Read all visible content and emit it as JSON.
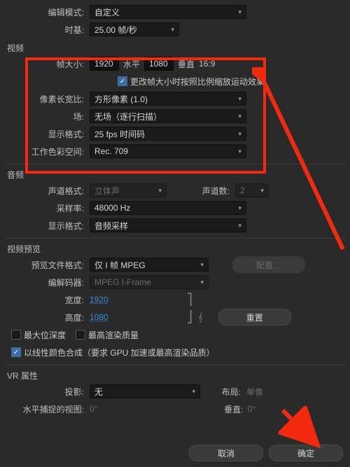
{
  "top": {
    "edit_mode_label": "编辑模式:",
    "edit_mode_value": "自定义",
    "timebase_label": "时基:",
    "timebase_value": "25.00 帧/秒"
  },
  "video": {
    "section": "视频",
    "frame_size_label": "帧大小:",
    "width": "1920",
    "h_label": "水平",
    "height": "1080",
    "v_label": "垂直",
    "ratio": "16:9",
    "scale_checkbox": "更改帧大小时按照比例缩放运动效果",
    "pixel_ar_label": "像素长宽比:",
    "pixel_ar_value": "方形像素 (1.0)",
    "fields_label": "场:",
    "fields_value": "无场（逐行扫描）",
    "disp_fmt_label": "显示格式:",
    "disp_fmt_value": "25 fps 时间码",
    "colorspace_label": "工作色彩空间:",
    "colorspace_value": "Rec. 709"
  },
  "audio": {
    "section": "音频",
    "ch_fmt_label": "声道格式:",
    "ch_fmt_value": "立体声",
    "ch_count_label": "声道数:",
    "ch_count_value": "2",
    "sample_rate_label": "采样率:",
    "sample_rate_value": "48000 Hz",
    "disp_fmt_label": "显示格式:",
    "disp_fmt_value": "音频采样"
  },
  "preview": {
    "section": "视频预览",
    "file_fmt_label": "预览文件格式:",
    "file_fmt_value": "仅 I 帧 MPEG",
    "config_btn": "配置…",
    "codec_label": "编解码器:",
    "codec_value": "MPEG I-Frame",
    "width_label": "宽度:",
    "width_value": "1920",
    "height_label": "高度:",
    "height_value": "1080",
    "reset_btn": "重置",
    "max_depth": "最大位深度",
    "max_quality": "最高渲染质量",
    "linear_comp": "以线性颜色合成（要求 GPU 加速或最高渲染品质）"
  },
  "vr": {
    "section": "VR 属性",
    "proj_label": "投影:",
    "proj_value": "无",
    "layout_label": "布局:",
    "layout_value": "单像",
    "hfov_label": "水平捕捉的视图:",
    "hfov_value": "0°",
    "vfov_label": "垂直:",
    "vfov_value": "0°"
  },
  "footer": {
    "cancel": "取消",
    "ok": "确定"
  },
  "icons": {
    "chev": "▾",
    "check": "✓",
    "link": "⎘"
  }
}
